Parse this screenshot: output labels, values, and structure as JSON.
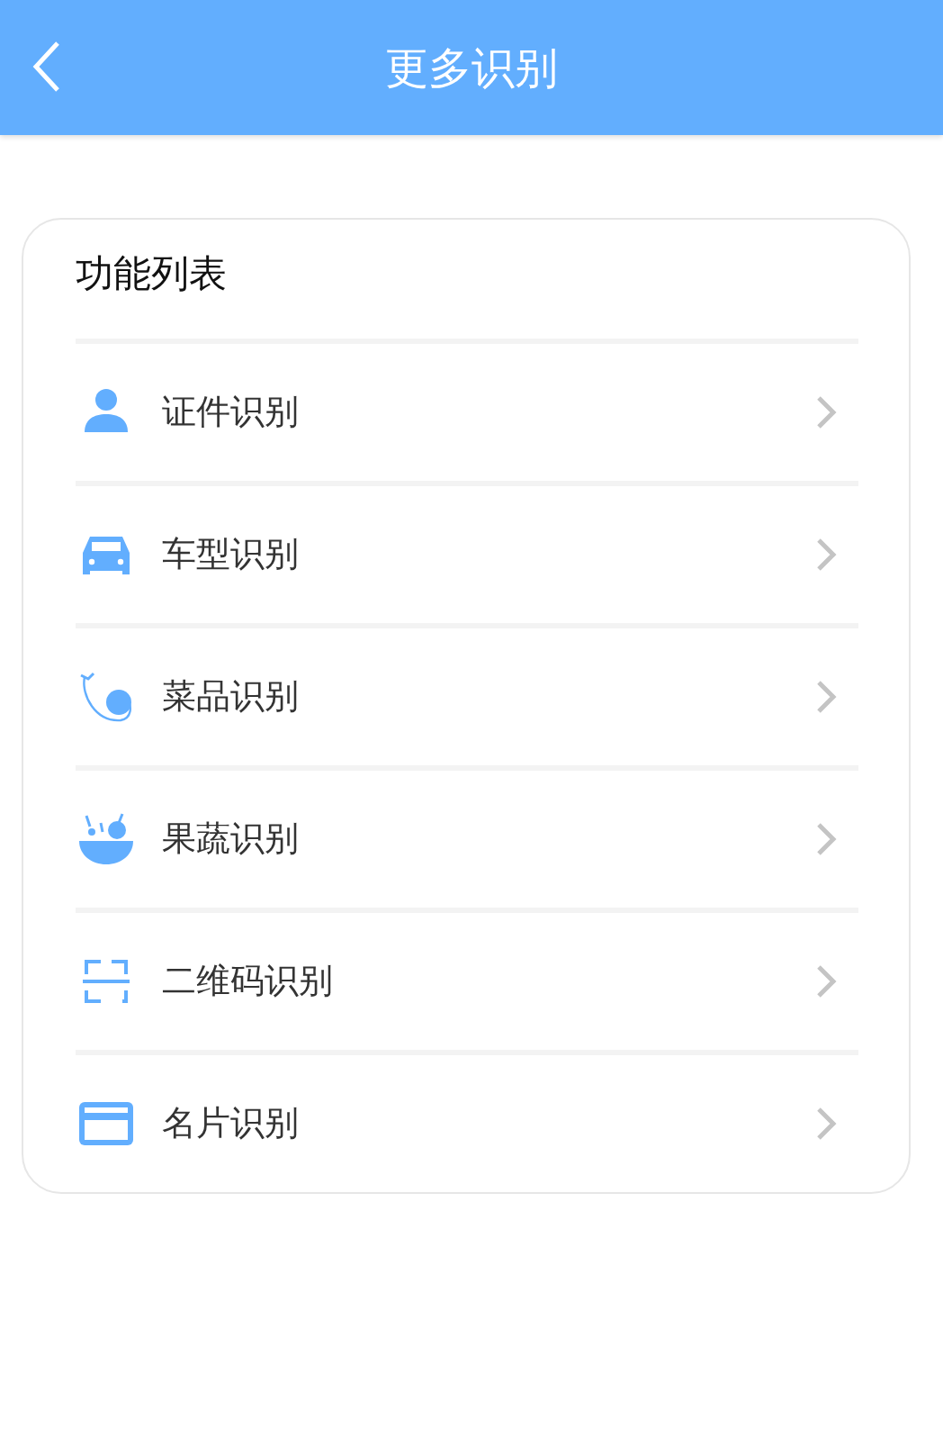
{
  "header": {
    "title": "更多识别"
  },
  "card": {
    "title": "功能列表"
  },
  "items": [
    {
      "kind": "person",
      "label": "证件识别"
    },
    {
      "kind": "car",
      "label": "车型识别"
    },
    {
      "kind": "dish",
      "label": "菜品识别"
    },
    {
      "kind": "fruit",
      "label": "果蔬识别"
    },
    {
      "kind": "qr",
      "label": "二维码识别"
    },
    {
      "kind": "card",
      "label": "名片识别"
    }
  ]
}
